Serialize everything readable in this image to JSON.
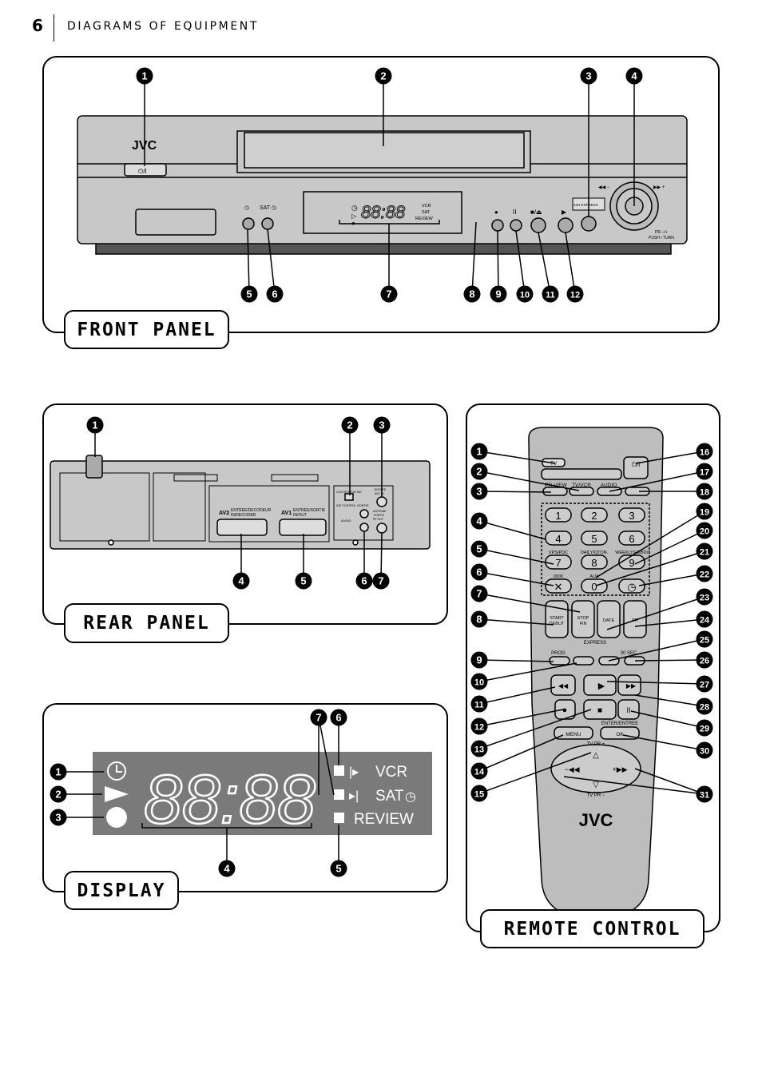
{
  "header": {
    "page_number": "6",
    "title": "DIAGRAMS OF EQUIPMENT"
  },
  "front_panel": {
    "label": "FRONT PANEL",
    "brand": "JVC",
    "power_button": "⏻/I",
    "timer_label": "◷",
    "sat_label": "SAT ◷",
    "display_digits": "88:88",
    "display_indicators": [
      "VCR",
      "SAT",
      "REVIEW"
    ],
    "button_symbols": [
      "●",
      "II",
      "■/⏏",
      "▶"
    ],
    "express_label": "24H EXPRESS",
    "jog_labels": {
      "rew": "◀◀ −",
      "ff": "▶▶ +",
      "pr": "PR −/+",
      "push": "PUSH / TURN"
    },
    "callouts": [
      "1",
      "2",
      "3",
      "4",
      "5",
      "6",
      "7",
      "8",
      "9",
      "10",
      "11",
      "12"
    ]
  },
  "rear_panel": {
    "label": "REAR PANEL",
    "av2": "AV2",
    "av2_text": [
      "ENTREE/DECODEUR",
      "IN/DECODER"
    ],
    "av1": "AV1",
    "av1_text": [
      "ENTREE/SORTIE",
      "IN/OUT"
    ],
    "sat_control": [
      "CONTROLEUR SAT",
      "SAT CONTROL"
    ],
    "sortie": "SORTIE",
    "audio": "AUDIO",
    "antenna_in": [
      "ENTREE",
      "ANT IN"
    ],
    "antenna_out": [
      "ANTENNE",
      "SORTIE",
      "RF OUT"
    ],
    "callouts": [
      "1",
      "2",
      "3",
      "4",
      "5",
      "6",
      "7"
    ]
  },
  "display": {
    "label": "DISPLAY",
    "digits": "88:88",
    "indicators": [
      "VCR",
      "SAT",
      "REVIEW"
    ],
    "callouts": [
      "1",
      "2",
      "3",
      "4",
      "5",
      "6",
      "7"
    ]
  },
  "remote_control": {
    "label": "REMOTE CONTROL",
    "brand": "JVC",
    "tv": "TV",
    "power": "⏻/I",
    "top_labels": [
      "PR VIEW",
      "TV/VCR",
      "AUDIO"
    ],
    "keys": [
      "1",
      "2",
      "3",
      "4",
      "5",
      "6",
      "7",
      "8",
      "9",
      "0"
    ],
    "key_labels": [
      "VPS/PDC",
      "DAILY/QTON.",
      "WEEKLY/HEBDO",
      "0000",
      "AUX"
    ],
    "time_buttons": [
      [
        "START",
        "DEBUT"
      ],
      [
        "STOP",
        "FIN"
      ],
      [
        "DATE"
      ],
      [
        "PR"
      ]
    ],
    "express": "EXPRESS",
    "prog": "PROG",
    "sec30": "30 SEC",
    "menu": "MENU",
    "ok": "OK",
    "enter": "ENTER/ENTREE",
    "tv_pr_plus": "TV  PR +",
    "tv_pr_minus": "TV  PR −",
    "callouts": [
      "1",
      "2",
      "3",
      "4",
      "5",
      "6",
      "7",
      "8",
      "9",
      "10",
      "11",
      "12",
      "13",
      "14",
      "15",
      "16",
      "17",
      "18",
      "19",
      "20",
      "21",
      "22",
      "23",
      "24",
      "25",
      "26",
      "27",
      "28",
      "29",
      "30",
      "31"
    ]
  },
  "colors": {
    "display_bg": "#7a7a7a",
    "device_grey": "#c8c8c8",
    "remote_grey": "#bdbdbd"
  }
}
